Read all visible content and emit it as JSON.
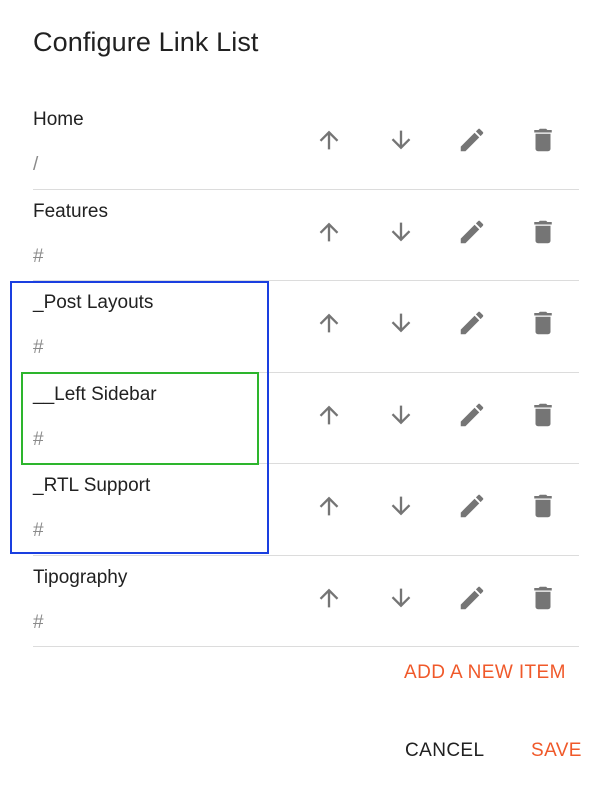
{
  "dialog": {
    "title": "Configure Link List"
  },
  "links": [
    {
      "title": "Home",
      "url": "/"
    },
    {
      "title": "Features",
      "url": "#"
    },
    {
      "title": "_Post Layouts",
      "url": "#"
    },
    {
      "title": "__Left Sidebar",
      "url": "#"
    },
    {
      "title": "_RTL Support",
      "url": "#"
    },
    {
      "title": "Tipography",
      "url": "#"
    }
  ],
  "icons": {
    "up": "arrow-up-icon",
    "down": "arrow-down-icon",
    "edit": "pencil-icon",
    "delete": "trash-icon"
  },
  "actions": {
    "add_item": "ADD A NEW ITEM",
    "cancel": "CANCEL",
    "save": "SAVE"
  },
  "colors": {
    "accent": "#f0592a",
    "icon": "#757575",
    "highlight_group": "#1a3fe0",
    "highlight_item": "#2db52d"
  }
}
